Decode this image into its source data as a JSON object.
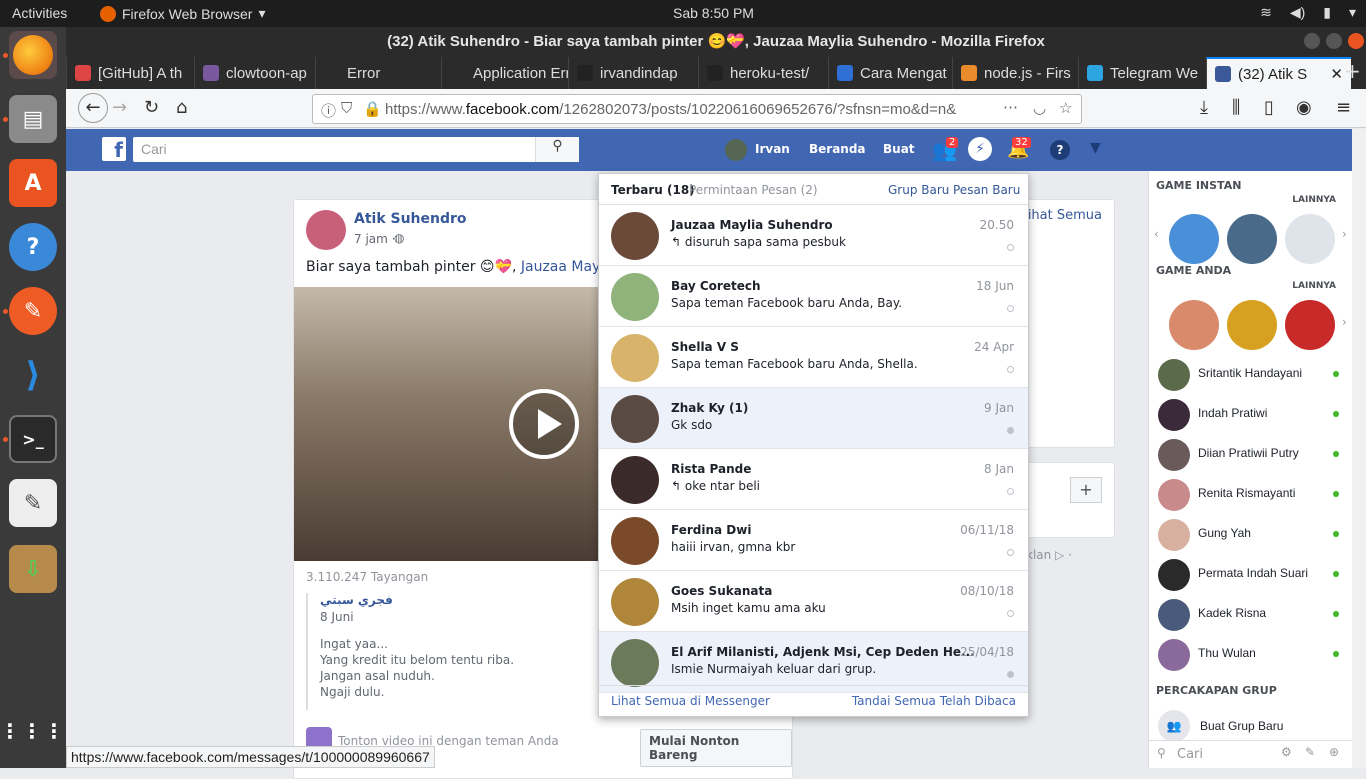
{
  "system": {
    "activities": "Activities",
    "app_name": "Firefox Web Browser",
    "clock": "Sab  8:50 PM"
  },
  "window": {
    "title": "(32) Atik Suhendro - Biar saya tambah pinter 😊💝, Jauzaa Maylia Suhendro - Mozilla Firefox"
  },
  "tabs": [
    {
      "label": "[GitHub] A th",
      "color": "#d44"
    },
    {
      "label": "clowtoon-ap",
      "color": "#79589f"
    },
    {
      "label": "Error",
      "color": "#2b2b2b"
    },
    {
      "label": "Application Erro",
      "color": "#2b2b2b"
    },
    {
      "label": "irvandindap",
      "color": "#222"
    },
    {
      "label": "heroku-test/",
      "color": "#222"
    },
    {
      "label": "Cara Mengat",
      "color": "#2f6fd6"
    },
    {
      "label": "node.js - Firs",
      "color": "#e98a2b"
    },
    {
      "label": "Telegram We",
      "color": "#2ca5e0"
    },
    {
      "label": "(32) Atik S",
      "color": "#3b5998"
    }
  ],
  "url": {
    "prefix": "https://www.",
    "domain": "facebook.com",
    "path": "/1262802073/posts/10220616069652676/?sfnsn=mo&d=n&"
  },
  "fb": {
    "search_placeholder": "Cari",
    "user": "Irvan",
    "home": "Beranda",
    "create": "Buat",
    "friend_badge": "2",
    "notif_badge": "32"
  },
  "post": {
    "author": "Atik Suhendro",
    "time": "7 jam ·",
    "text": "Biar saya tambah pinter 😊💝, ",
    "tag": "Jauzaa Maylia",
    "views": "3.110.247 Tayangan",
    "shared_name": "فجري سبتي",
    "shared_date": "8 Juni",
    "shared_lines": [
      "Ingat yaa...",
      "Yang kredit itu belom tentu riba.",
      "Jangan asal nuduh.",
      "Ngaji dulu."
    ],
    "watch_hint": "Tonton video ini dengan teman Anda",
    "watch_button": "Mulai Nonton Bareng"
  },
  "side": {
    "see_all": "Lihat Semua",
    "ad_label": "klan ▷ ·"
  },
  "messenger": {
    "recent_label": "Terbaru",
    "recent_count": "(18)",
    "requests_label": "Permintaan Pesan (2)",
    "new_group": "Grup Baru",
    "new_message": "Pesan Baru",
    "footer_left": "Lihat Semua di Messenger",
    "footer_right": "Tandai Semua Telah Dibaca",
    "threads": [
      {
        "name": "Jauzaa Maylia Suhendro",
        "text": "↰ disuruh sapa sama pesbuk",
        "date": "20.50",
        "unread": false,
        "color": "#6b4a3a"
      },
      {
        "name": "Bay Coretech",
        "text": "Sapa teman Facebook baru Anda, Bay.",
        "date": "18 Jun",
        "unread": false,
        "color": "#8fb37a"
      },
      {
        "name": "Shella V S",
        "text": "Sapa teman Facebook baru Anda, Shella.",
        "date": "24 Apr",
        "unread": false,
        "color": "#d8b36a"
      },
      {
        "name": "Zhak Ky (1)",
        "text": "Gk sdo",
        "date": "9 Jan",
        "unread": true,
        "color": "#5a4a44"
      },
      {
        "name": "Rista Pande",
        "text": "↰ oke ntar beli",
        "date": "8 Jan",
        "unread": false,
        "color": "#3a2a2a"
      },
      {
        "name": "Ferdina Dwi",
        "text": "haiii irvan, gmna kbr",
        "date": "06/11/18",
        "unread": false,
        "color": "#7a4a2a"
      },
      {
        "name": "Goes Sukanata",
        "text": "Msih inget kamu ama aku",
        "date": "08/10/18",
        "unread": false,
        "color": "#b0873a"
      },
      {
        "name": "El Arif Milanisti, Adjenk Msi, Cep Deden He...",
        "text": "Ismie Nurmaiyah keluar dari grup.",
        "date": "25/04/18",
        "unread": true,
        "color": "#6a7a5a"
      }
    ]
  },
  "rightbar": {
    "instant_games": "GAME INSTAN",
    "more1": "LAINNYA",
    "your_games": "GAME ANDA",
    "more2": "LAINNYA",
    "contacts": [
      {
        "name": "Sritantik Handayani",
        "color": "#5a6a4a"
      },
      {
        "name": "Indah Pratiwi",
        "color": "#3a2a3a"
      },
      {
        "name": "Diian Pratiwii Putry",
        "color": "#6a5a5a"
      },
      {
        "name": "Renita Rismayanti",
        "color": "#c88a8a"
      },
      {
        "name": "Gung Yah",
        "color": "#d8b0a0"
      },
      {
        "name": "Permata Indah Suari",
        "color": "#2a2a2a"
      },
      {
        "name": "Kadek Risna",
        "color": "#4a5a7a"
      },
      {
        "name": "Thu Wulan",
        "color": "#8a6a9a"
      }
    ],
    "group_chats": "PERCAKAPAN GRUP",
    "create_group": "Buat Grup Baru",
    "search_placeholder": "Cari"
  },
  "statusbar": "https://www.facebook.com/messages/t/100000089960667"
}
